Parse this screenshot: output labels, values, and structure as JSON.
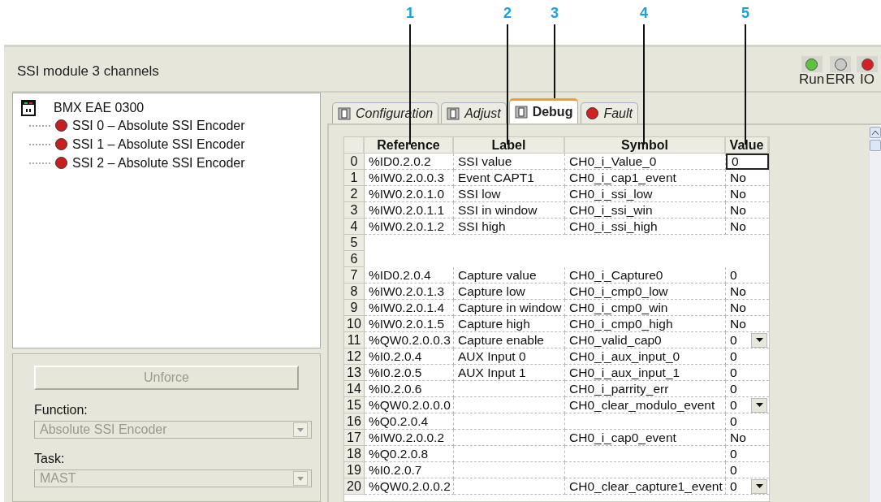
{
  "callouts": [
    "1",
    "2",
    "3",
    "4",
    "5"
  ],
  "module": {
    "title": "SSI module 3 channels",
    "leds": [
      {
        "label": "Run",
        "color": "#5cc43a"
      },
      {
        "label": "ERR",
        "color": "#c8c8c8"
      },
      {
        "label": "IO",
        "color": "#d42020"
      }
    ]
  },
  "tree": {
    "label": "BMX EAE 0300",
    "children": [
      {
        "label": "SSI 0 – Absolute SSI Encoder",
        "color": "#c81e1e"
      },
      {
        "label": "SSI 1 – Absolute SSI Encoder",
        "color": "#c81e1e"
      },
      {
        "label": "SSI 2 – Absolute SSI Encoder",
        "color": "#c81e1e"
      }
    ]
  },
  "controls": {
    "unforce": {
      "label": "Unforce",
      "disabled": true
    },
    "function": {
      "label": "Function:",
      "value": "Absolute SSI Encoder",
      "disabled": true
    },
    "task": {
      "label": "Task:",
      "value": "MAST",
      "disabled": true
    }
  },
  "tabs": [
    {
      "label": "Configuration",
      "kind": "module",
      "selected": false
    },
    {
      "label": "Adjust",
      "kind": "module",
      "selected": false
    },
    {
      "label": "Debug",
      "kind": "module",
      "selected": true
    },
    {
      "label": "Fault",
      "kind": "fault",
      "selected": false
    }
  ],
  "table": {
    "columns": [
      "Reference",
      "Label",
      "Symbol",
      "Value"
    ],
    "rows": [
      {
        "index": "0",
        "reference": "%ID0.2.0.2",
        "label": "SSI value",
        "symbol": "CH0_i_Value_0",
        "value": "0",
        "kind": "text",
        "selected": true
      },
      {
        "index": "1",
        "reference": "%IW0.2.0.0.3",
        "label": "Event CAPT1",
        "symbol": "CH0_i_cap1_event",
        "value": "No",
        "kind": "text",
        "selected": false
      },
      {
        "index": "2",
        "reference": "%IW0.2.0.1.0",
        "label": "SSI low",
        "symbol": "CH0_i_ssi_low",
        "value": "No",
        "kind": "text",
        "selected": false
      },
      {
        "index": "3",
        "reference": "%IW0.2.0.1.1",
        "label": "SSI in window",
        "symbol": "CH0_i_ssi_win",
        "value": "No",
        "kind": "text",
        "selected": false
      },
      {
        "index": "4",
        "reference": "%IW0.2.0.1.2",
        "label": "SSI high",
        "symbol": "CH0_i_ssi_high",
        "value": "No",
        "kind": "text",
        "selected": false
      },
      {
        "index": "5",
        "kind": "empty",
        "selected": false
      },
      {
        "index": "6",
        "kind": "empty",
        "selected": false
      },
      {
        "index": "7",
        "reference": "%ID0.2.0.4",
        "label": "Capture value",
        "symbol": "CH0_i_Capture0",
        "value": "0",
        "kind": "text",
        "selected": false
      },
      {
        "index": "8",
        "reference": "%IW0.2.0.1.3",
        "label": "Capture low",
        "symbol": "CH0_i_cmp0_low",
        "value": "No",
        "kind": "text",
        "selected": false
      },
      {
        "index": "9",
        "reference": "%IW0.2.0.1.4",
        "label": "Capture in window",
        "symbol": "CH0_i_cmp0_win",
        "value": "No",
        "kind": "text",
        "selected": false
      },
      {
        "index": "10",
        "reference": "%IW0.2.0.1.5",
        "label": "Capture high",
        "symbol": "CH0_i_cmp0_high",
        "value": "No",
        "kind": "text",
        "selected": false
      },
      {
        "index": "11",
        "reference": "%QW0.2.0.0.3",
        "label": "Capture enable",
        "symbol": "CH0_valid_cap0",
        "value": "0",
        "kind": "dropdown",
        "selected": false
      },
      {
        "index": "12",
        "reference": "%I0.2.0.4",
        "label": "AUX Input 0",
        "symbol": "CH0_i_aux_input_0",
        "value": "0",
        "kind": "text",
        "selected": false
      },
      {
        "index": "13",
        "reference": "%I0.2.0.5",
        "label": "AUX Input 1",
        "symbol": "CH0_i_aux_input_1",
        "value": "0",
        "kind": "text",
        "selected": false
      },
      {
        "index": "14",
        "reference": "%I0.2.0.6",
        "symbol": "CH0_i_parrity_err",
        "value": "0",
        "kind": "text",
        "selected": false
      },
      {
        "index": "15",
        "reference": "%QW0.2.0.0.0",
        "symbol": "CH0_clear_modulo_event",
        "value": "0",
        "kind": "dropdown",
        "selected": false
      },
      {
        "index": "16",
        "reference": "%Q0.2.0.4",
        "value": "0",
        "kind": "text",
        "selected": false
      },
      {
        "index": "17",
        "reference": "%IW0.2.0.0.2",
        "symbol": "CH0_i_cap0_event",
        "value": "No",
        "kind": "text",
        "selected": false
      },
      {
        "index": "18",
        "reference": "%Q0.2.0.8",
        "value": "0",
        "kind": "text",
        "selected": false
      },
      {
        "index": "19",
        "reference": "%I0.2.0.7",
        "value": "0",
        "kind": "text",
        "selected": false
      },
      {
        "index": "20",
        "reference": "%QW0.2.0.0.2",
        "symbol": "CH0_clear_capture1_event",
        "value": "0",
        "kind": "dropdown",
        "selected": false
      }
    ]
  }
}
